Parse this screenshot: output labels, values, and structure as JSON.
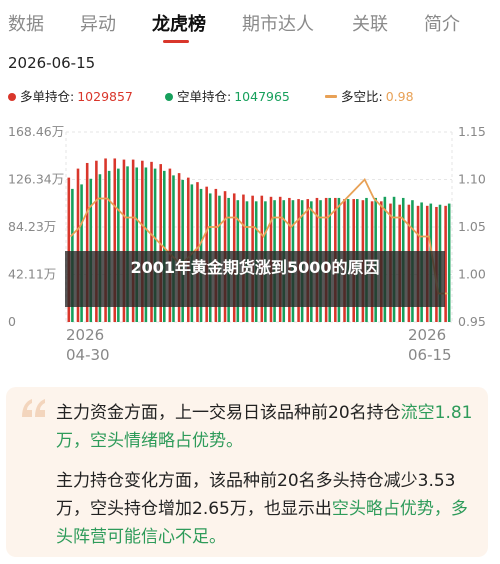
{
  "tabs": [
    {
      "label": "数据"
    },
    {
      "label": "异动"
    },
    {
      "label": "龙虎榜"
    },
    {
      "label": "期市达人"
    },
    {
      "label": "关联"
    },
    {
      "label": "简介"
    }
  ],
  "active_tab": "龙虎榜",
  "date": "2026-06-15",
  "legend": {
    "long": {
      "label": "多单持仓:",
      "value": "1029857",
      "color": "#d9362b"
    },
    "short": {
      "label": "空单持仓:",
      "value": "1047965",
      "color": "#17a05c"
    },
    "ratio": {
      "label": "多空比:",
      "value": "0.98",
      "color": "#e8a156"
    }
  },
  "overlay": {
    "text": "2001年黄金期货涨到5000的原因"
  },
  "chart_data": {
    "type": "bar",
    "x_start": "2026 04-30",
    "x_end": "2026 06-15",
    "x_tick_labels": [
      [
        "2026",
        "04-30"
      ],
      [
        "2026",
        "06-15"
      ]
    ],
    "y_left_ticks": [
      "168.46万",
      "126.34万",
      "84.23万",
      "42.11万",
      "0"
    ],
    "y_left_range": [
      0,
      168.46
    ],
    "y_right_ticks": [
      "1.15",
      "1.10",
      "1.05",
      "1.00",
      "0.95"
    ],
    "y_right_range": [
      0.95,
      1.15
    ],
    "grid": true,
    "series": [
      {
        "name": "多单持仓",
        "color": "#d9362b",
        "values": [
          128,
          136,
          141,
          143,
          145,
          145,
          144,
          144,
          143,
          142,
          140,
          136,
          132,
          128,
          124,
          120,
          118,
          116,
          114,
          113,
          112,
          112,
          111,
          111,
          110,
          109,
          109,
          110,
          110,
          110,
          109,
          109,
          108,
          107,
          107,
          105,
          104,
          104,
          103,
          103,
          102,
          103
        ]
      },
      {
        "name": "空单持仓",
        "color": "#17a05c",
        "values": [
          118,
          122,
          127,
          131,
          134,
          136,
          138,
          137,
          137,
          136,
          134,
          130,
          126,
          122,
          118,
          114,
          112,
          110,
          108,
          107,
          107,
          107,
          108,
          108,
          108,
          108,
          107,
          108,
          110,
          110,
          109,
          109,
          110,
          110,
          111,
          111,
          110,
          108,
          106,
          105,
          104,
          105
        ]
      },
      {
        "name": "多空比",
        "color": "#e8a156",
        "values": [
          1.04,
          1.05,
          1.07,
          1.08,
          1.08,
          1.07,
          1.06,
          1.06,
          1.05,
          1.04,
          1.03,
          1.02,
          1.01,
          1.02,
          1.03,
          1.05,
          1.05,
          1.06,
          1.06,
          1.05,
          1.05,
          1.04,
          1.06,
          1.06,
          1.05,
          1.06,
          1.07,
          1.06,
          1.06,
          1.07,
          1.08,
          1.09,
          1.1,
          1.08,
          1.07,
          1.06,
          1.06,
          1.05,
          1.04,
          1.04,
          0.98,
          0.98
        ]
      }
    ]
  },
  "card": {
    "p1_a": "主力资金方面，上一交易日该品种前20名持仓",
    "p1_b": "流空1.81万，空头情绪略占优势。",
    "p2_a": "主力持仓变化方面，该品种前20名多头持仓减少3.53万，空头持仓增加2.65万，也显示出",
    "p2_b": "空头略占优势，多头阵营可能信心不足。"
  }
}
